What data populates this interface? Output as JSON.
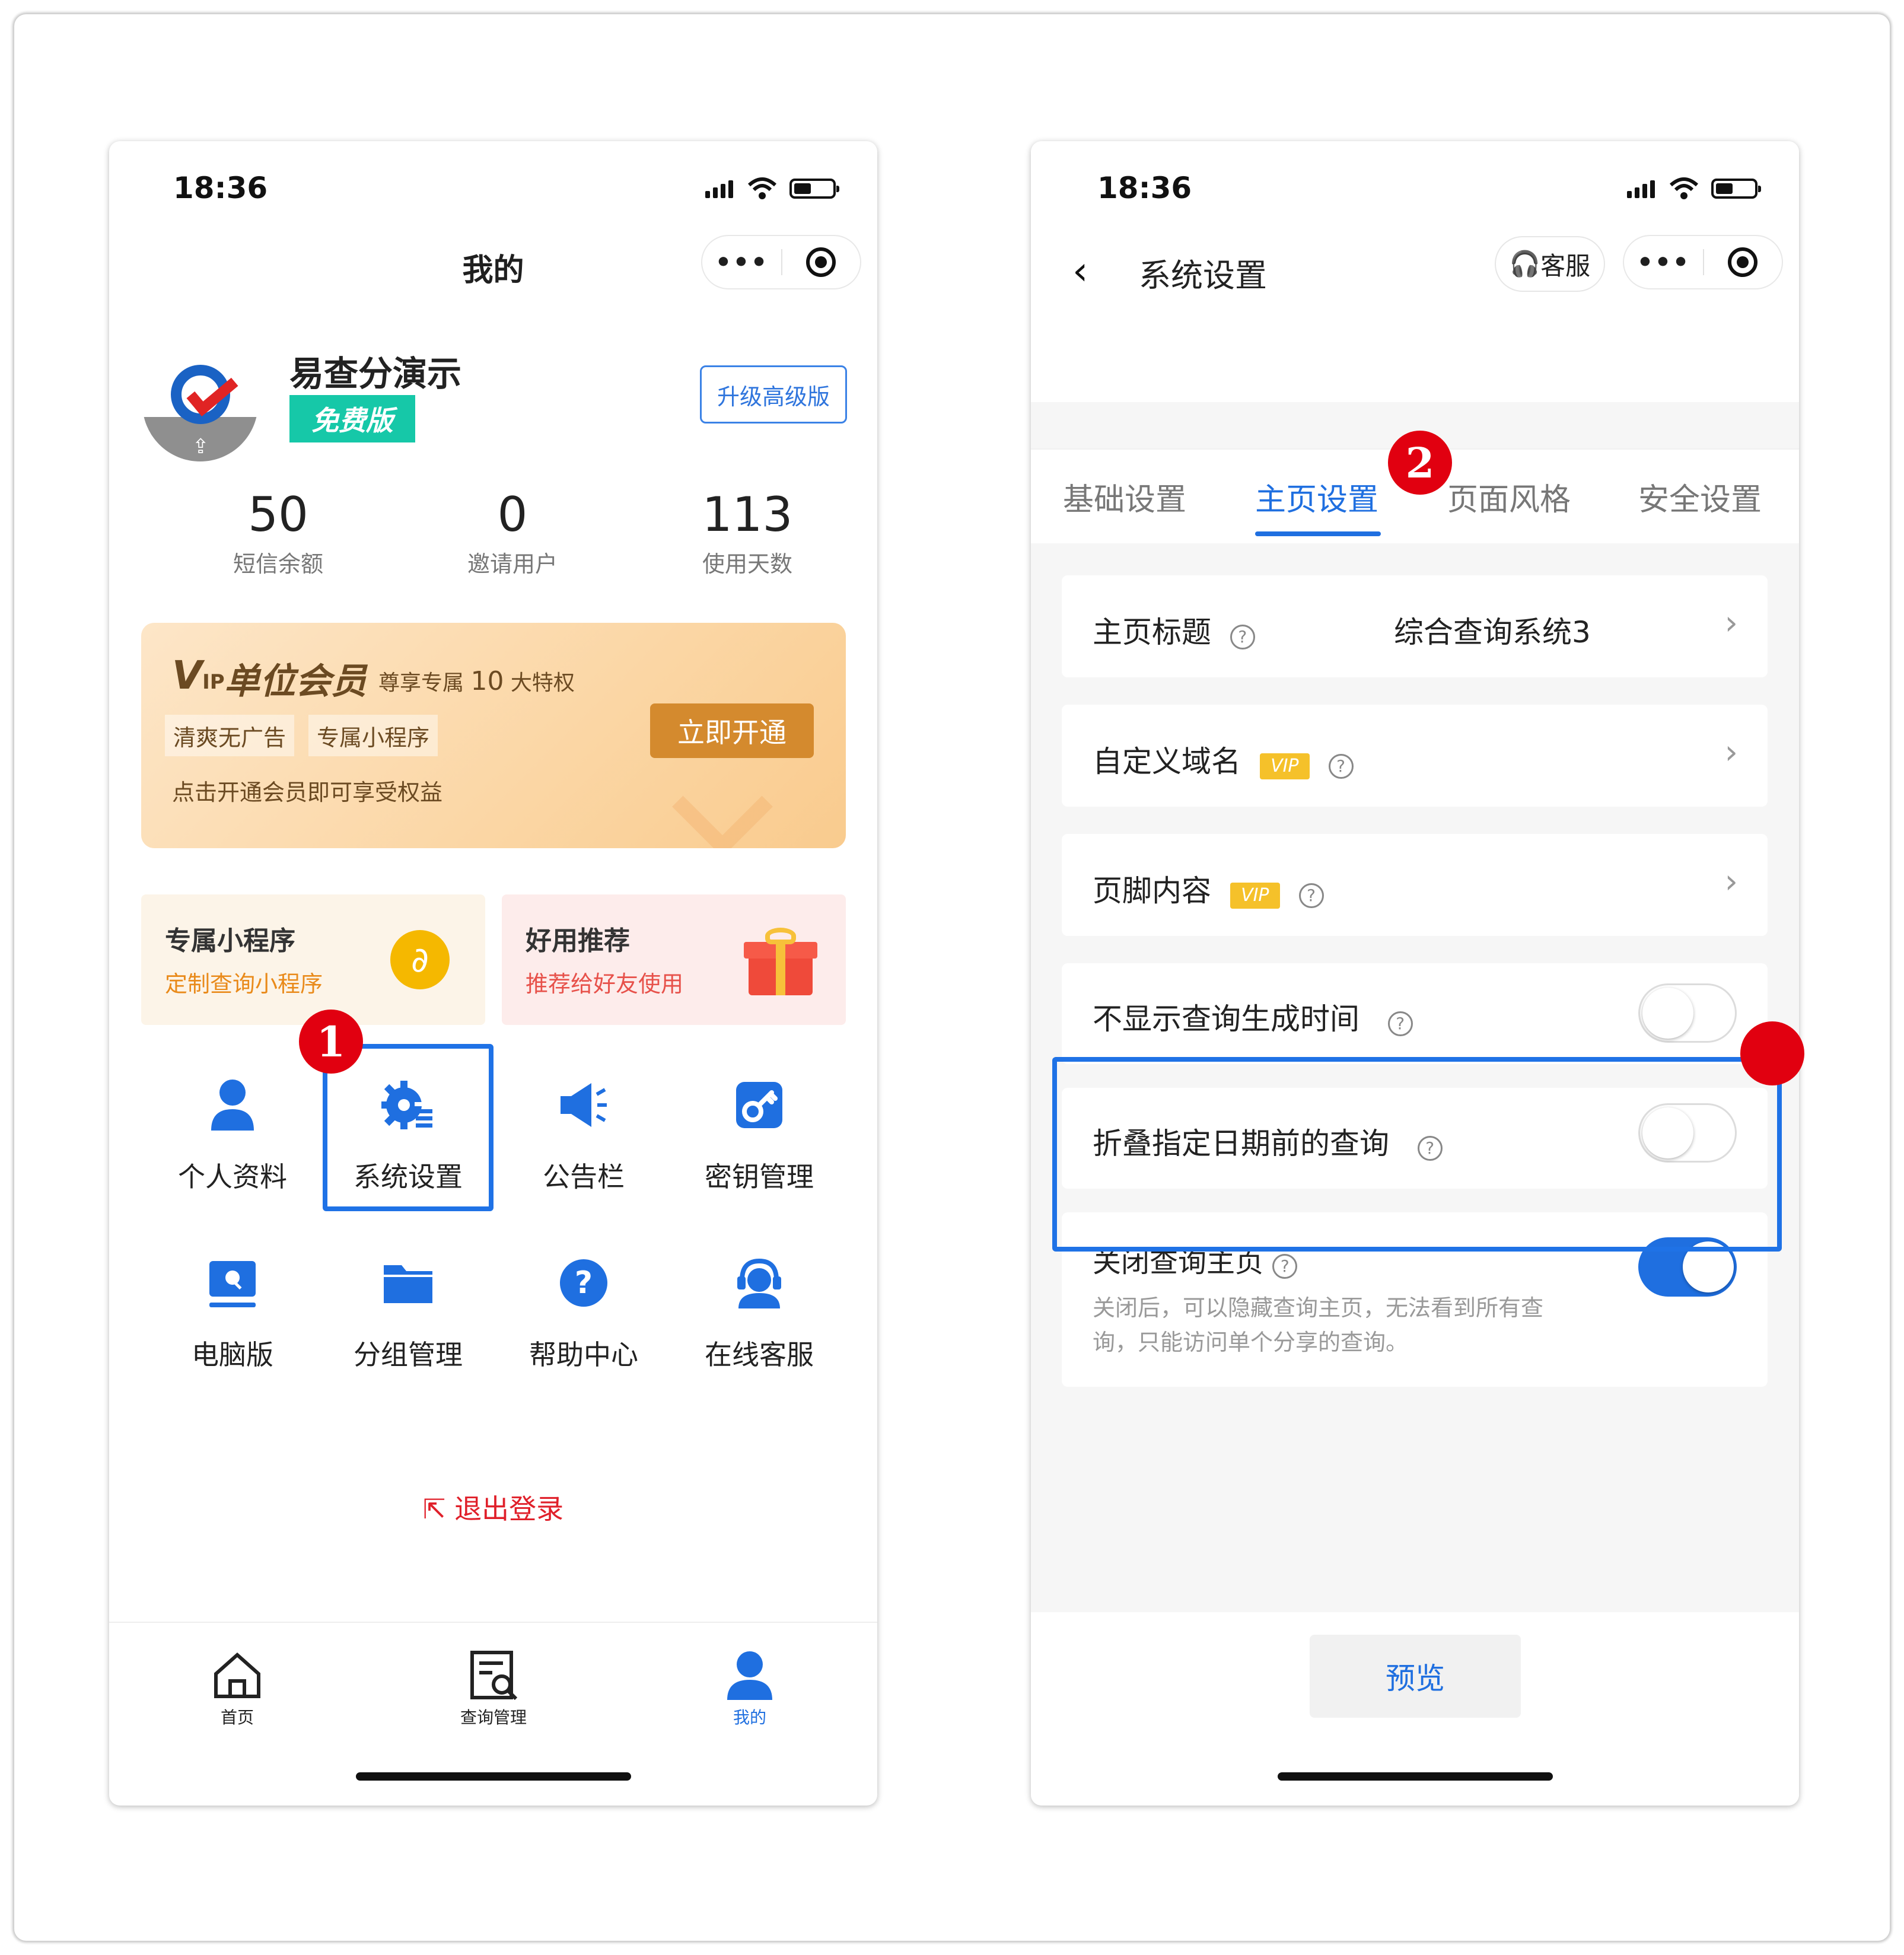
{
  "left_phone": {
    "status_time": "18:36",
    "title": "我的",
    "profile": {
      "name": "易查分演示",
      "plan_badge": "免费版",
      "upgrade_label": "升级高级版"
    },
    "stats": [
      {
        "value": "50",
        "label": "短信余额"
      },
      {
        "value": "0",
        "label": "邀请用户"
      },
      {
        "value": "113",
        "label": "使用天数"
      }
    ],
    "vip_banner": {
      "logo_big": "V",
      "logo_small": "IP",
      "title": "单位会员",
      "subtitle_prefix": "尊享专属",
      "subtitle_num": "10",
      "subtitle_suffix": "大特权",
      "tags": [
        "清爽无广告",
        "专属小程序"
      ],
      "desc": "点击开通会员即可享受权益",
      "button": "立即开通"
    },
    "promos": [
      {
        "title": "专属小程序",
        "subtitle": "定制查询小程序",
        "color": "#e98a1a"
      },
      {
        "title": "好用推荐",
        "subtitle": "推荐给好友使用",
        "color": "#e7514a"
      }
    ],
    "grid": [
      {
        "label": "个人资料",
        "icon": "person-icon"
      },
      {
        "label": "系统设置",
        "icon": "gear-icon"
      },
      {
        "label": "公告栏",
        "icon": "megaphone-icon"
      },
      {
        "label": "密钥管理",
        "icon": "key-icon"
      },
      {
        "label": "电脑版",
        "icon": "computer-icon"
      },
      {
        "label": "分组管理",
        "icon": "folder-icon"
      },
      {
        "label": "帮助中心",
        "icon": "help-icon"
      },
      {
        "label": "在线客服",
        "icon": "service-icon"
      }
    ],
    "step_badge": "1",
    "logout": "退出登录",
    "tabbar": [
      {
        "label": "首页",
        "icon": "home-icon"
      },
      {
        "label": "查询管理",
        "icon": "query-manage-icon"
      },
      {
        "label": "我的",
        "icon": "me-icon",
        "active": true
      }
    ]
  },
  "right_phone": {
    "status_time": "18:36",
    "title": "系统设置",
    "service_label": "客服",
    "tabs": [
      {
        "label": "基础设置",
        "active": false
      },
      {
        "label": "主页设置",
        "active": true
      },
      {
        "label": "页面风格",
        "active": false
      },
      {
        "label": "安全设置",
        "active": false
      }
    ],
    "step_badge": "2",
    "settings": [
      {
        "label": "主页标题",
        "value": "综合查询系统3",
        "vip": false,
        "type": "link"
      },
      {
        "label": "自定义域名",
        "vip": true,
        "type": "link"
      },
      {
        "label": "页脚内容",
        "vip": true,
        "type": "link"
      },
      {
        "label": "不显示查询生成时间",
        "type": "toggle",
        "on": false
      },
      {
        "label": "折叠指定日期前的查询",
        "type": "toggle",
        "on": false
      },
      {
        "label": "关闭查询主页",
        "type": "toggle",
        "on": true,
        "desc_line1": "关闭后，可以隐藏查询主页，无法看到所有查",
        "desc_line2": "询，只能访问单个分享的查询。"
      }
    ],
    "vip_chip": "VIP",
    "preview_button": "预览"
  },
  "colors": {
    "accent_blue": "#1f6fe0",
    "badge_red": "#e10010",
    "free_green": "#16c8a8",
    "vip_brown": "#6b4a22"
  }
}
